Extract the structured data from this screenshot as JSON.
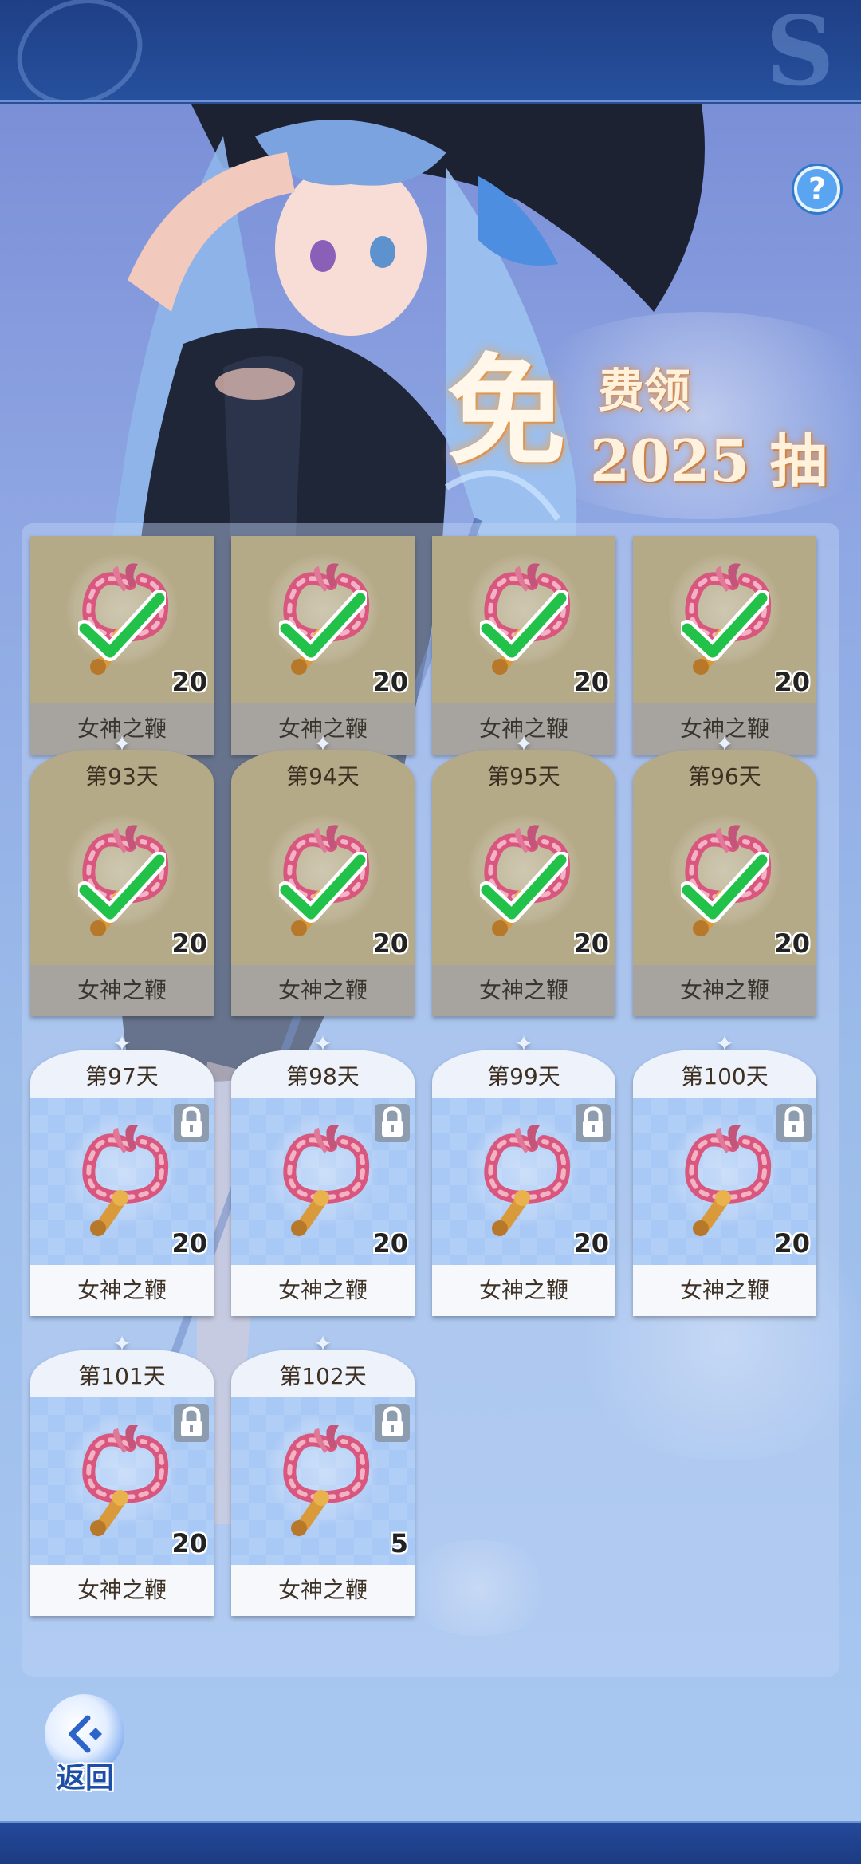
{
  "header": {
    "help_icon": "question-icon",
    "help_symbol": "?"
  },
  "promo": {
    "big_char": "免",
    "line1": "费领",
    "line2": "2025 抽"
  },
  "rewards": [
    {
      "day": "",
      "item": "女神之鞭",
      "qty": "20",
      "status": "claimed"
    },
    {
      "day": "",
      "item": "女神之鞭",
      "qty": "20",
      "status": "claimed"
    },
    {
      "day": "",
      "item": "女神之鞭",
      "qty": "20",
      "status": "claimed"
    },
    {
      "day": "",
      "item": "女神之鞭",
      "qty": "20",
      "status": "claimed"
    },
    {
      "day": "第93天",
      "item": "女神之鞭",
      "qty": "20",
      "status": "claimed"
    },
    {
      "day": "第94天",
      "item": "女神之鞭",
      "qty": "20",
      "status": "claimed"
    },
    {
      "day": "第95天",
      "item": "女神之鞭",
      "qty": "20",
      "status": "claimed"
    },
    {
      "day": "第96天",
      "item": "女神之鞭",
      "qty": "20",
      "status": "claimed"
    },
    {
      "day": "第97天",
      "item": "女神之鞭",
      "qty": "20",
      "status": "locked"
    },
    {
      "day": "第98天",
      "item": "女神之鞭",
      "qty": "20",
      "status": "locked"
    },
    {
      "day": "第99天",
      "item": "女神之鞭",
      "qty": "20",
      "status": "locked"
    },
    {
      "day": "第100天",
      "item": "女神之鞭",
      "qty": "20",
      "status": "locked"
    },
    {
      "day": "第101天",
      "item": "女神之鞭",
      "qty": "20",
      "status": "locked"
    },
    {
      "day": "第102天",
      "item": "女神之鞭",
      "qty": "5",
      "status": "locked"
    }
  ],
  "footer": {
    "back_label": "返回",
    "back_icon": "back-arrow-icon"
  },
  "colors": {
    "claimed_card": "#b5aa88",
    "locked_card": "#a8c8f5",
    "check": "#22c24a",
    "title_glow": "#e6a45a"
  }
}
